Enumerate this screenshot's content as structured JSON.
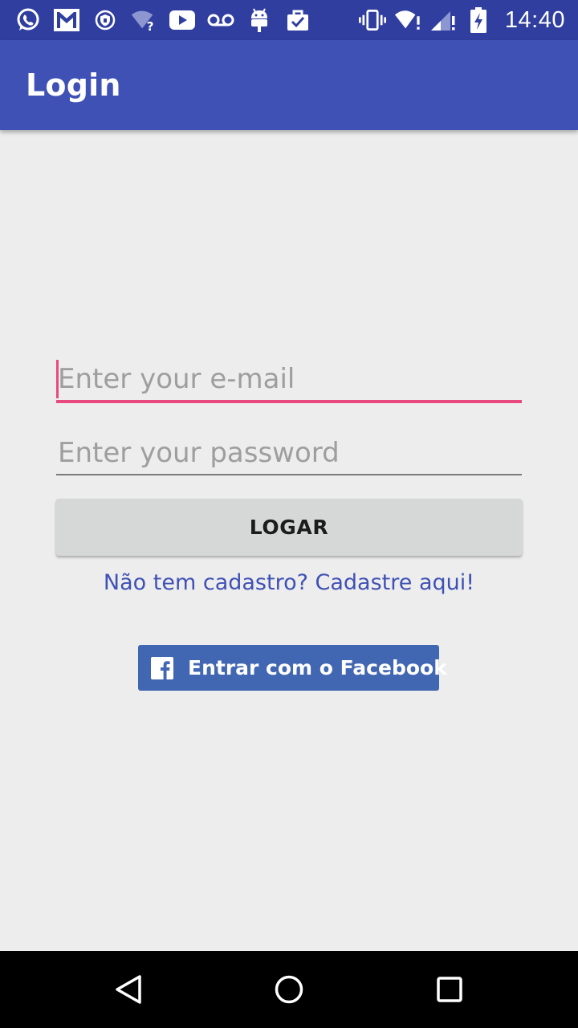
{
  "status_bar": {
    "time": "14:40",
    "left_icons": [
      "whatsapp-icon",
      "gmail-icon",
      "vpn-shield-icon",
      "wifi-question-icon",
      "youtube-icon",
      "voicemail-icon",
      "android-debug-icon",
      "clipboard-check-icon"
    ],
    "right_icons": [
      "vibrate-icon",
      "wifi-alert-icon",
      "signal-alert-icon",
      "battery-charging-icon"
    ]
  },
  "app_bar": {
    "title": "Login",
    "color": "#3f51b5"
  },
  "form": {
    "email_placeholder": "Enter your e-mail",
    "email_value": "",
    "password_placeholder": "Enter your password",
    "password_value": "",
    "login_label": "LOGAR",
    "register_link": "Não tem cadastro? Cadastre aqui!",
    "accent_color": "#e84a7f"
  },
  "facebook": {
    "label": "Entrar com o Facebook",
    "icon": "facebook-icon",
    "color": "#4267b2"
  },
  "nav_bar": {
    "buttons": [
      "back-icon",
      "home-icon",
      "recents-icon"
    ]
  }
}
